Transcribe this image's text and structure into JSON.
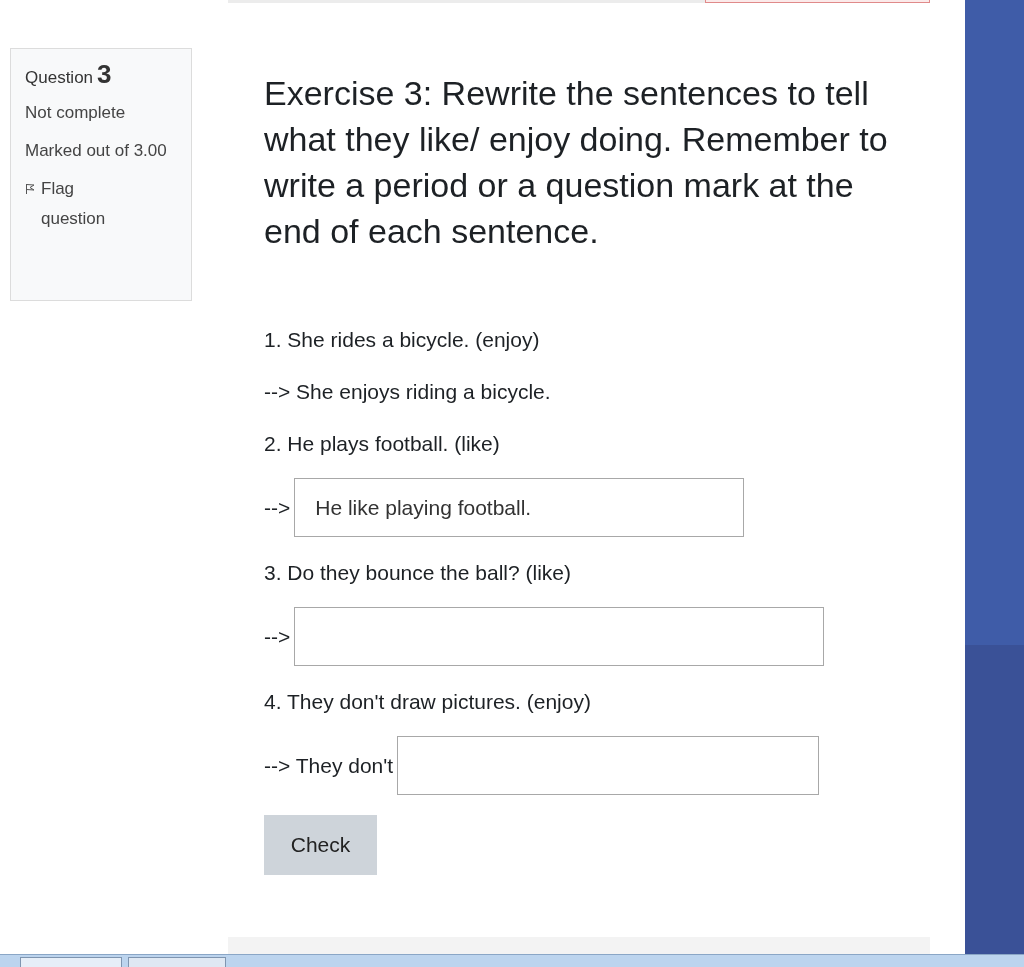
{
  "question_info": {
    "label": "Question",
    "number": "3",
    "status": "Not complete",
    "marks": "Marked out of 3.00",
    "flag": "Flag question"
  },
  "exercise": {
    "title": "Exercise 3: Rewrite the sentences to tell what they like/ enjoy doing. Remember to write a period or a question mark at the end of each sentence.",
    "items": [
      {
        "prompt": "1. She rides a bicycle. (enjoy)",
        "kind": "example",
        "prefix": "-->",
        "answer": "She enjoys riding a bicycle."
      },
      {
        "prompt": "2. He plays football. (like)",
        "kind": "field",
        "prefix": "-->",
        "value": "He like playing football."
      },
      {
        "prompt": "3. Do they bounce the ball? (like)",
        "kind": "field",
        "prefix": "-->",
        "value": ""
      },
      {
        "prompt": "4. They don't draw pictures. (enjoy)",
        "kind": "field",
        "prefix": "--> They don't",
        "value": ""
      }
    ],
    "check_button": "Check"
  }
}
